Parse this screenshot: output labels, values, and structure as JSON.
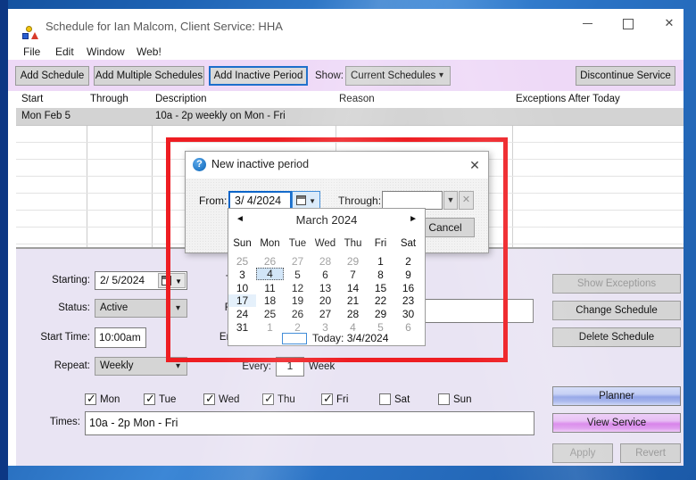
{
  "window": {
    "title": "Schedule for Ian Malcom, Client Service: HHA",
    "minimize": "minimize",
    "maximize": "maximize",
    "close": "✕"
  },
  "menu": {
    "file": "File",
    "edit": "Edit",
    "window": "Window",
    "web": "Web!"
  },
  "toolbar": {
    "add_schedule": "Add Schedule",
    "add_multiple_schedules": "Add Multiple Schedules",
    "add_inactive_period": "Add Inactive Period",
    "show_label": "Show:",
    "show_value": "Current Schedules",
    "discontinue_service": "Discontinue Service"
  },
  "grid": {
    "columns": {
      "start": "Start",
      "through": "Through",
      "description": "Description",
      "reason": "Reason",
      "exceptions": "Exceptions After Today"
    },
    "rows": [
      {
        "start": "Mon Feb 5",
        "through": "",
        "description": "10a - 2p weekly on Mon - Fri",
        "reason": "",
        "exceptions": ""
      }
    ]
  },
  "form": {
    "starting_label": "Starting:",
    "starting_value": "2/ 5/2024",
    "status_label": "Status:",
    "status_value": "Active",
    "start_time_label": "Start Time:",
    "start_time_value": "10:00am",
    "repeat_label": "Repeat:",
    "repeat_value": "Weekly",
    "through_label": "T",
    "reason_label": "R",
    "end_time_label": "En",
    "every_label": "Every:",
    "every_value": "1",
    "week_label": "Week",
    "days": [
      {
        "label": "Mon",
        "checked": "✓"
      },
      {
        "label": "Tue",
        "checked": "✓"
      },
      {
        "label": "Wed",
        "checked": "✓"
      },
      {
        "label": "Thu",
        "checked": "✓"
      },
      {
        "label": "Fri",
        "checked": "✓"
      },
      {
        "label": "Sat",
        "checked": ""
      },
      {
        "label": "Sun",
        "checked": ""
      }
    ],
    "times_label": "Times:",
    "times_value": "10a - 2p Mon - Fri"
  },
  "actions": {
    "show_exceptions": "Show Exceptions",
    "change_schedule": "Change Schedule",
    "delete_schedule": "Delete Schedule",
    "planner": "Planner",
    "view_service": "View Service",
    "apply": "Apply",
    "revert": "Revert"
  },
  "dialog": {
    "title": "New inactive period",
    "help_icon": "?",
    "close": "✕",
    "from_label": "From:",
    "from_value": "3/ 4/2024",
    "through_label": "Through:",
    "through_value": "",
    "through_dropdown": "▼",
    "through_clear": "✕",
    "cancel": "Cancel",
    "calendar": {
      "month": "March 2024",
      "prev": "◄",
      "next": "►",
      "daynames": [
        "Sun",
        "Mon",
        "Tue",
        "Wed",
        "Thu",
        "Fri",
        "Sat"
      ],
      "weeks": [
        [
          "25",
          "26",
          "27",
          "28",
          "29",
          "1",
          "2"
        ],
        [
          "3",
          "4",
          "5",
          "6",
          "7",
          "8",
          "9"
        ],
        [
          "10",
          "11",
          "12",
          "13",
          "14",
          "15",
          "16"
        ],
        [
          "17",
          "18",
          "19",
          "20",
          "21",
          "22",
          "23"
        ],
        [
          "24",
          "25",
          "26",
          "27",
          "28",
          "29",
          "30"
        ],
        [
          "31",
          "1",
          "2",
          "3",
          "4",
          "5",
          "6"
        ]
      ],
      "selected_day": "4",
      "hovered_day": "17",
      "today": "Today: 3/4/2024"
    }
  },
  "colors": {
    "toolbar": "#eed9f7",
    "form_panel": "#e9e4f3",
    "highlight_box": "#ee1d22",
    "focus_border": "#1c6ecb",
    "selected_row": "#d3d3d3"
  }
}
